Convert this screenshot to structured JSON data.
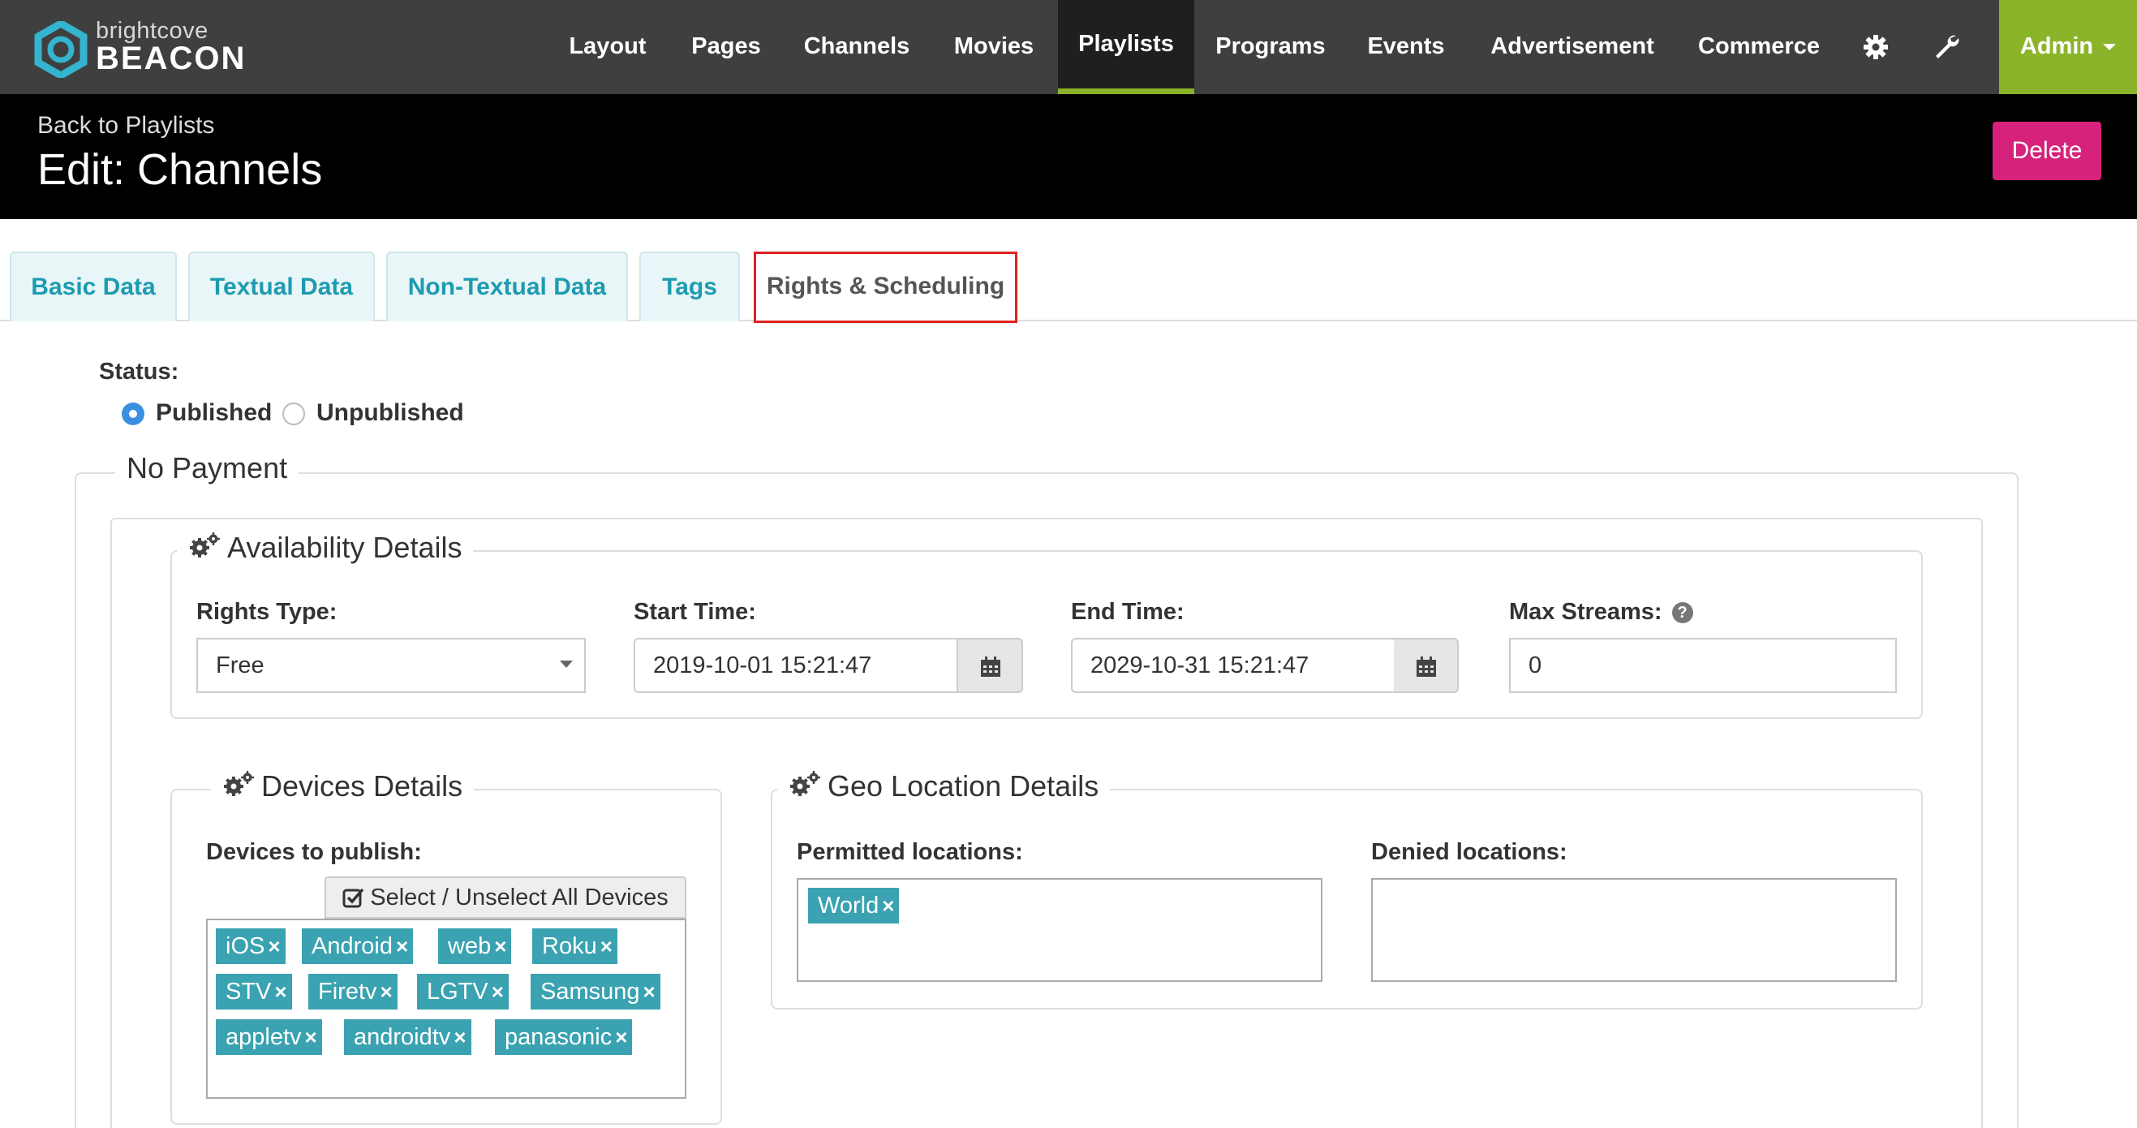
{
  "brand": {
    "small": "brightcove",
    "big": "BEACON"
  },
  "nav": {
    "items": [
      "Layout",
      "Pages",
      "Channels",
      "Movies",
      "Playlists",
      "Programs",
      "Events",
      "Advertisement",
      "Commerce"
    ],
    "active": "Playlists",
    "admin_label": "Admin",
    "accent_color": "#8cb42a"
  },
  "header": {
    "back_label": "Back to Playlists",
    "title": "Edit: Channels",
    "delete_label": "Delete"
  },
  "tabs": [
    {
      "label": "Basic Data"
    },
    {
      "label": "Textual Data"
    },
    {
      "label": "Non-Textual Data"
    },
    {
      "label": "Tags"
    },
    {
      "label": "Rights & Scheduling",
      "active": true
    }
  ],
  "status": {
    "label": "Status:",
    "options": [
      {
        "label": "Published",
        "checked": true
      },
      {
        "label": "Unpublished",
        "checked": false
      }
    ]
  },
  "payment": {
    "legend": "No Payment"
  },
  "availability": {
    "legend": "Availability Details",
    "rights_type": {
      "label": "Rights Type:",
      "value": "Free"
    },
    "start_time": {
      "label": "Start Time:",
      "value": "2019-10-01 15:21:47"
    },
    "end_time": {
      "label": "End Time:",
      "value": "2029-10-31 15:21:47"
    },
    "max_streams": {
      "label": "Max Streams:",
      "value": "0"
    }
  },
  "devices": {
    "legend": "Devices Details",
    "label": "Devices to publish:",
    "select_all_label": "Select / Unselect All Devices",
    "tags": [
      "iOS",
      "Android",
      "web",
      "Roku",
      "STV",
      "Firetv",
      "LGTV",
      "Samsung",
      "appletv",
      "androidtv",
      "panasonic"
    ]
  },
  "geo": {
    "legend": "Geo Location Details",
    "permitted_label": "Permitted locations:",
    "permitted": [
      "World"
    ],
    "denied_label": "Denied locations:",
    "denied": []
  }
}
